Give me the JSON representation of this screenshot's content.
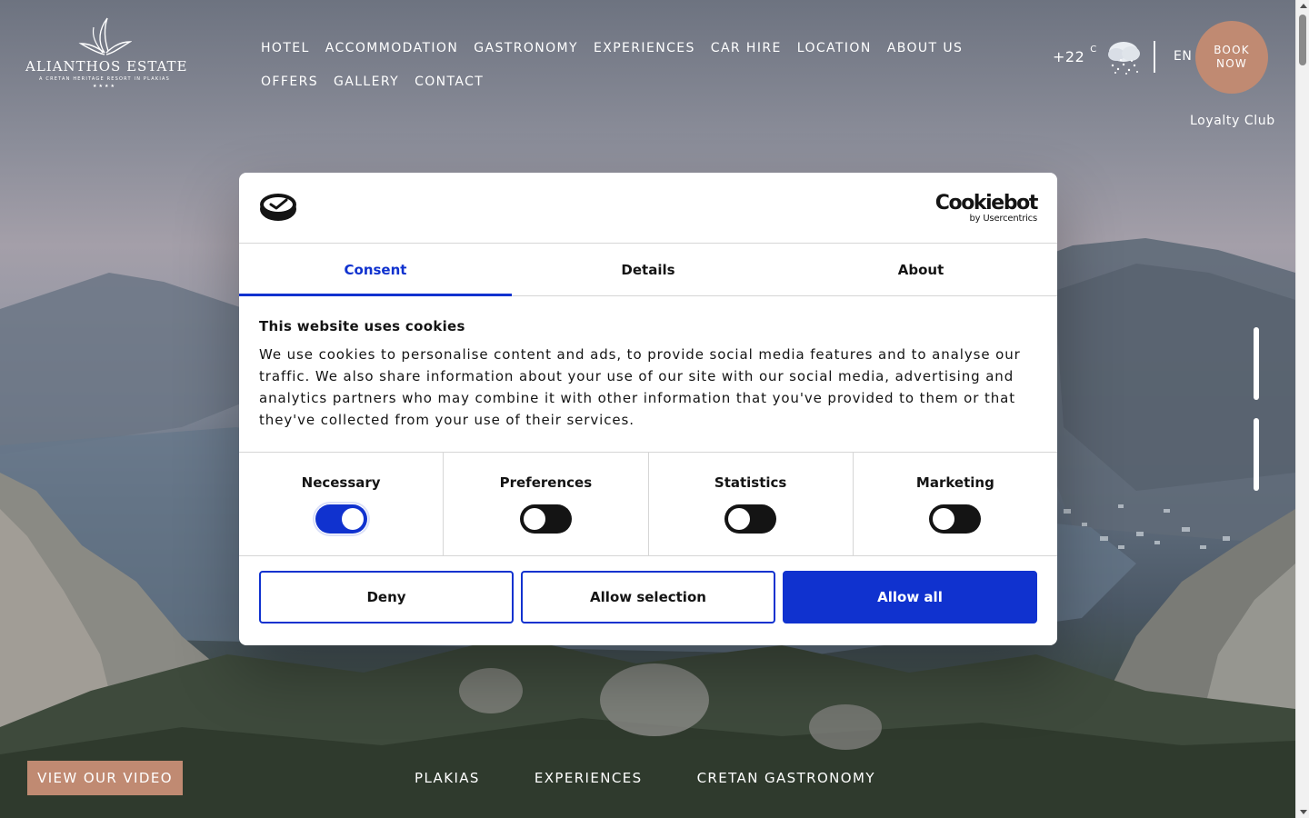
{
  "header": {
    "logo": {
      "title": "ALIANTHOS ESTATE",
      "subtitle": "A CRETAN HERITAGE RESORT IN PLAKIAS",
      "stars": "★★★★"
    },
    "nav_row1": [
      "HOTEL",
      "ACCOMMODATION",
      "GASTRONOMY",
      "EXPERIENCES",
      "CAR HIRE",
      "LOCATION",
      "ABOUT US"
    ],
    "nav_row2": [
      "OFFERS",
      "GALLERY",
      "CONTACT"
    ],
    "weather": {
      "temperature": "+22",
      "unit": "C",
      "icon": "snow-cloud-icon"
    },
    "language": "EN",
    "book_now": {
      "line1": "BOOK",
      "line2": "NOW"
    },
    "loyalty_club": "Loyalty Club"
  },
  "hero": {
    "video_button": "VIEW OUR VIDEO",
    "bottom_links": [
      "PLAKIAS",
      "EXPERIENCES",
      "CRETAN GASTRONOMY"
    ]
  },
  "cookie_dialog": {
    "brand": {
      "name": "Cookiebot",
      "by": "by Usercentrics"
    },
    "tabs": [
      {
        "label": "Consent",
        "active": true
      },
      {
        "label": "Details",
        "active": false
      },
      {
        "label": "About",
        "active": false
      }
    ],
    "title": "This website uses cookies",
    "text": "We use cookies to personalise content and ads, to provide social media features and to analyse our traffic. We also share information about your use of our site with our social media, advertising and analytics partners who may combine it with other information that you've provided to them or that they've collected from your use of their services.",
    "toggles": [
      {
        "label": "Necessary",
        "checked": true
      },
      {
        "label": "Preferences",
        "checked": false
      },
      {
        "label": "Statistics",
        "checked": false
      },
      {
        "label": "Marketing",
        "checked": false
      }
    ],
    "buttons": {
      "deny": "Deny",
      "allow_selection": "Allow selection",
      "allow_all": "Allow all"
    }
  },
  "colors": {
    "accent": "#1032cf",
    "brand_terracotta": "#c08a72",
    "text_dark": "#141414"
  }
}
